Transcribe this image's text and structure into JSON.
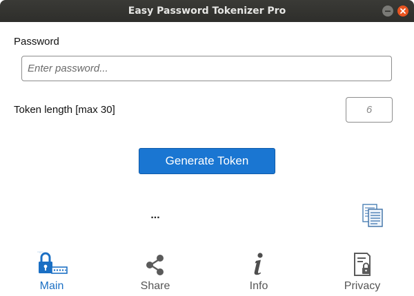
{
  "window": {
    "title": "Easy Password Tokenizer Pro"
  },
  "form": {
    "password_label": "Password",
    "password_placeholder": "Enter password...",
    "password_value": "",
    "token_length_label": "Token length [max 30]",
    "token_length_placeholder": "6",
    "token_length_value": ""
  },
  "actions": {
    "generate_label": "Generate Token"
  },
  "result": {
    "token_text": "...",
    "copy_icon": "copy-documents-icon"
  },
  "nav": {
    "items": [
      {
        "label": "Main",
        "icon": "lock-password-icon",
        "active": true
      },
      {
        "label": "Share",
        "icon": "share-icon",
        "active": false
      },
      {
        "label": "Info",
        "icon": "info-icon",
        "active": false
      },
      {
        "label": "Privacy",
        "icon": "privacy-document-icon",
        "active": false
      }
    ]
  },
  "colors": {
    "accent": "#1a76d2",
    "active_nav": "#1a6fc4",
    "inactive_nav": "#555555",
    "titlebar": "#2e2e2b",
    "close_button": "#e95420"
  }
}
